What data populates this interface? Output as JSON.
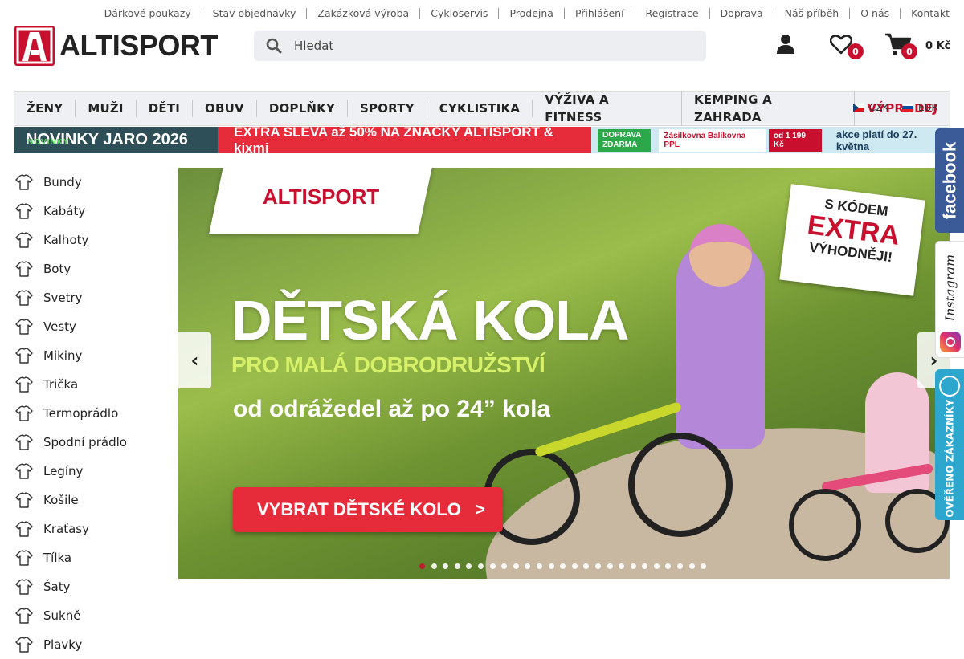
{
  "top_links": [
    "Dárkové poukazy",
    "Stav objednávky",
    "Zakázková výroba",
    "Cykloservis",
    "Prodejna",
    "Přihlášení",
    "Registrace",
    "Doprava",
    "Náš příběh",
    "O nás",
    "Kontakt"
  ],
  "logo": {
    "text": "ALTISPORT"
  },
  "search": {
    "placeholder": "Hledat"
  },
  "header": {
    "wishlist_count": "0",
    "cart_count": "0",
    "cart_total": "0 Kč"
  },
  "nav": {
    "items": [
      "ŽENY",
      "MUŽI",
      "DĚTI",
      "OBUV",
      "DOPLŇKY",
      "SPORTY",
      "CYKLISTIKA",
      "VÝŽIVA A FITNESS",
      "KEMPING A ZAHRADA"
    ],
    "sale": "VÝPRODEJ"
  },
  "currency": {
    "czk": "CZK",
    "eur": "EUR"
  },
  "promo": {
    "novinky_overlay": "NOVINKY",
    "novinky": "NOVINKY JARO 2026",
    "extra": "EXTRA SLEVA až 50% NA ZNAČKY ALTISPORT & kixmi",
    "doprava": "DOPRAVA ZDARMA",
    "carriers": "Zásilkovna Balíkovna PPL",
    "threshold": "od 1 199 Kč",
    "valid": "akce platí do 27. května"
  },
  "categories": [
    "Bundy",
    "Kabáty",
    "Kalhoty",
    "Boty",
    "Svetry",
    "Vesty",
    "Mikiny",
    "Trička",
    "Termoprádlo",
    "Spodní prádlo",
    "Legíny",
    "Košile",
    "Kraťasy",
    "Tílka",
    "Šaty",
    "Sukně",
    "Plavky"
  ],
  "banner": {
    "logo": "ALTISPORT",
    "headline": "DĚTSKÁ KOLA",
    "subheadline": "PRO MALÁ DOBRODRUŽSTVÍ",
    "tagline": "od odrážedel až po 24” kola",
    "cta": "VYBRAT DĚTSKÉ KOLO",
    "cta_arrow": ">",
    "sticker_top": "S KÓDEM",
    "sticker_main": "EXTRA",
    "sticker_bottom": "VÝHODNĚJI!",
    "slide_count": 25,
    "active_slide": 0
  },
  "social": {
    "facebook": "facebook",
    "instagram": "Instagram",
    "verified": "OVĚŘENO ZÁKAZNÍKY"
  },
  "colors": {
    "brand_red": "#c8102e",
    "promo_red": "#e62b3a",
    "facebook": "#3b5b98",
    "verified": "#2ea7cf"
  }
}
